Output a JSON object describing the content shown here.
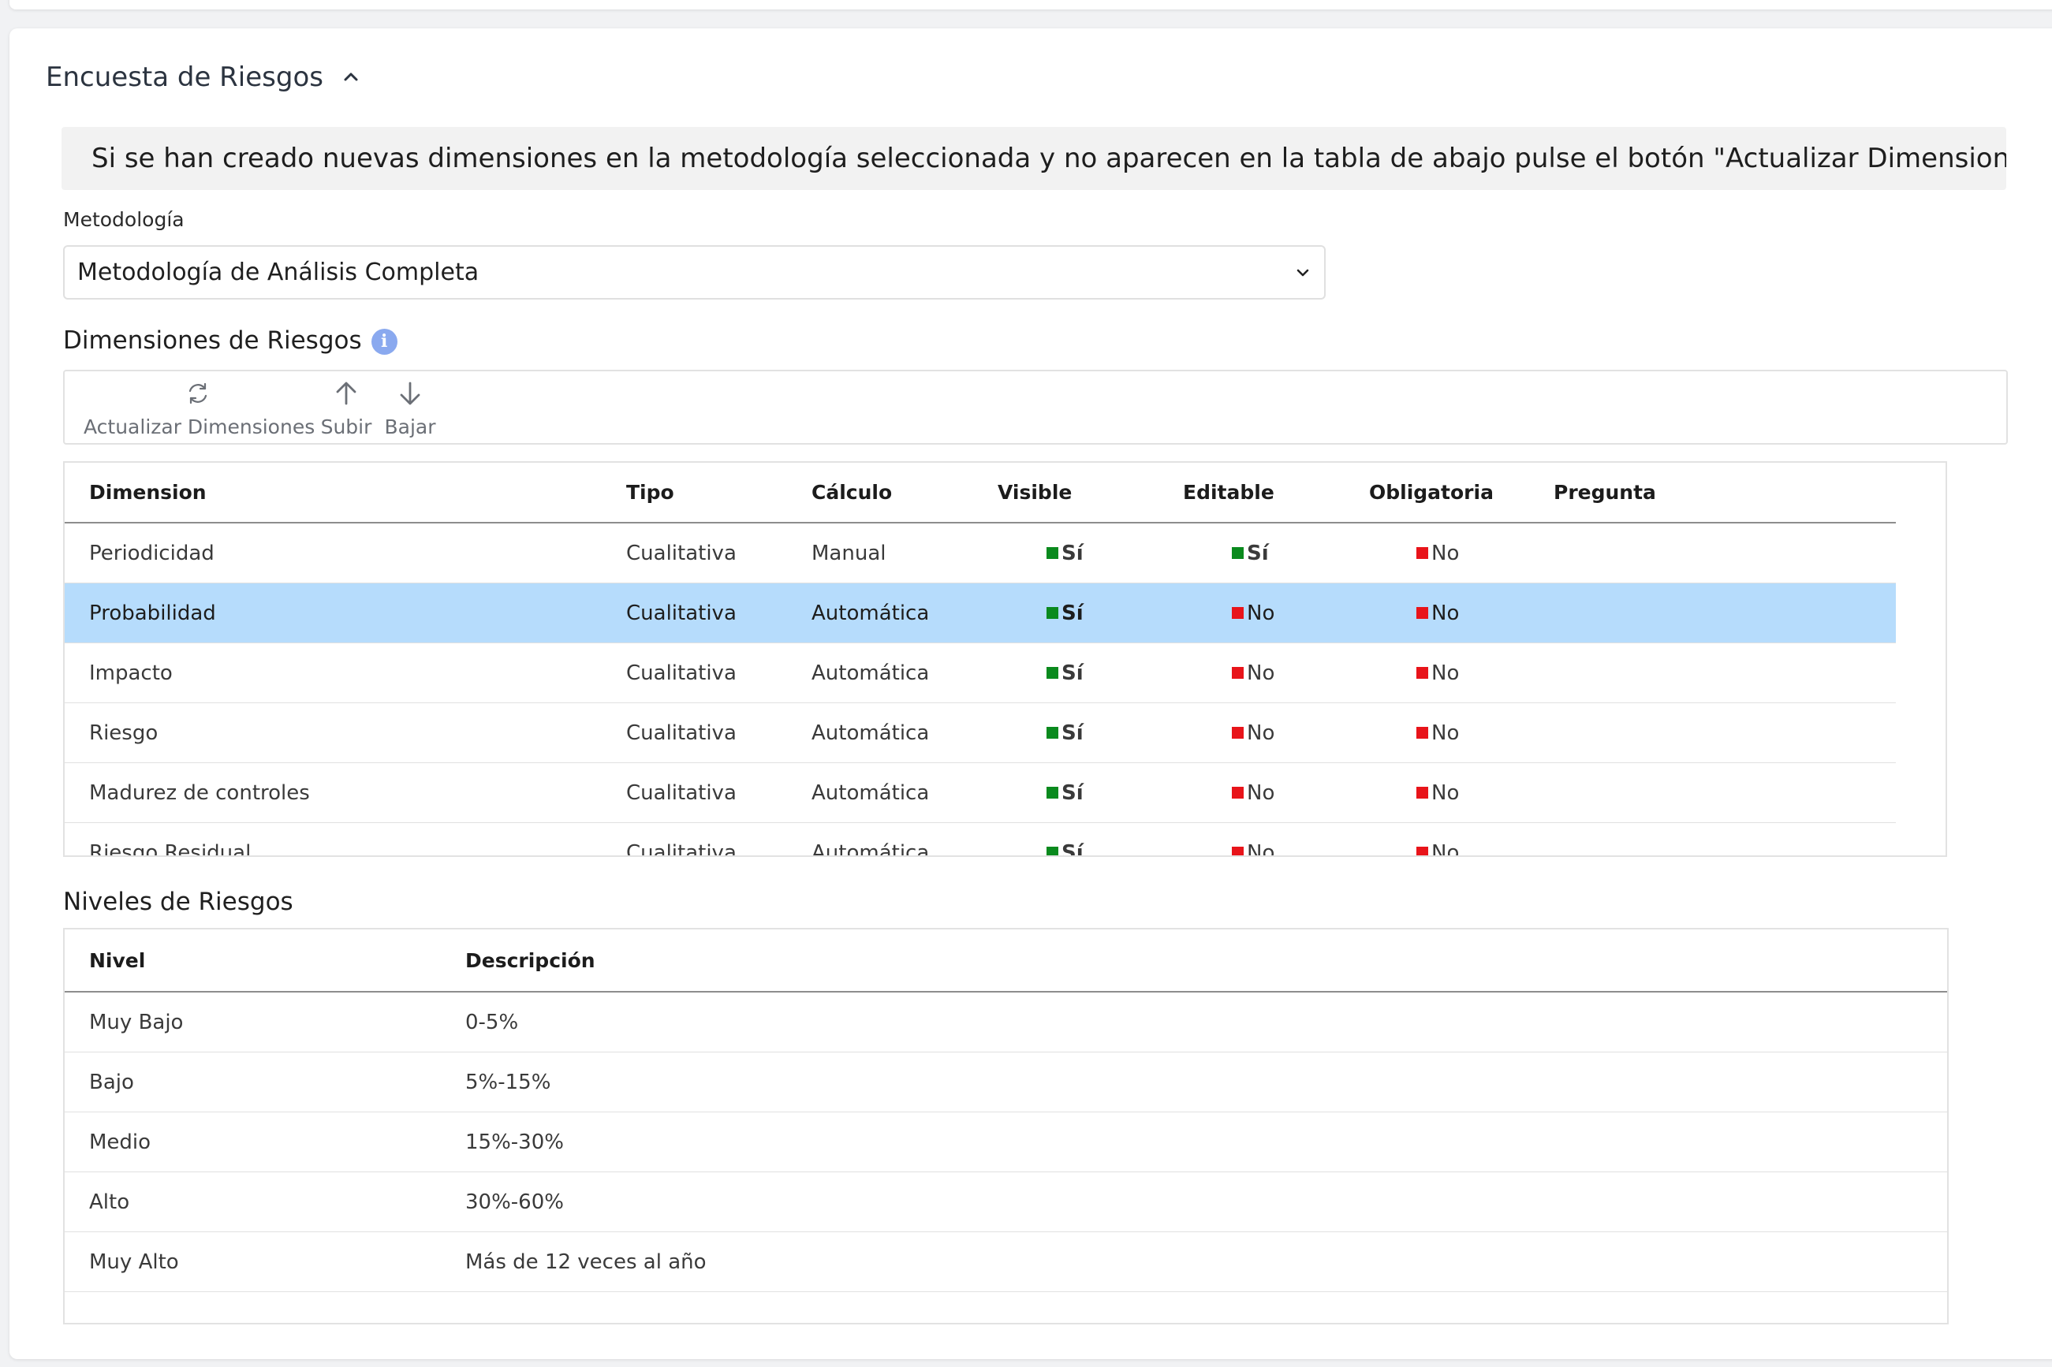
{
  "section": {
    "title": "Encuesta de Riesgos"
  },
  "banner": {
    "text": "Si se han creado nuevas dimensiones en la metodología seleccionada y no aparecen en la tabla de abajo pulse el botón \"Actualizar Dimensiones\""
  },
  "methodology": {
    "label": "Metodología",
    "selected": "Metodología de Análisis Completa"
  },
  "dimensions": {
    "title": "Dimensiones de Riesgos",
    "info_icon": "i",
    "toolbar": {
      "refresh_label": "Actualizar Dimensiones",
      "up_label": "Subir",
      "down_label": "Bajar"
    },
    "columns": [
      "Dimension",
      "Tipo",
      "Cálculo",
      "Visible",
      "Editable",
      "Obligatoria",
      "Pregunta"
    ],
    "rows": [
      {
        "dimension": "Periodicidad",
        "tipo": "Cualitativa",
        "calculo": "Manual",
        "visible": "Sí",
        "editable": "Sí",
        "obligatoria": "No",
        "pregunta": ""
      },
      {
        "dimension": "Probabilidad",
        "tipo": "Cualitativa",
        "calculo": "Automática",
        "visible": "Sí",
        "editable": "No",
        "obligatoria": "No",
        "pregunta": ""
      },
      {
        "dimension": "Impacto",
        "tipo": "Cualitativa",
        "calculo": "Automática",
        "visible": "Sí",
        "editable": "No",
        "obligatoria": "No",
        "pregunta": ""
      },
      {
        "dimension": "Riesgo",
        "tipo": "Cualitativa",
        "calculo": "Automática",
        "visible": "Sí",
        "editable": "No",
        "obligatoria": "No",
        "pregunta": ""
      },
      {
        "dimension": "Madurez de controles",
        "tipo": "Cualitativa",
        "calculo": "Automática",
        "visible": "Sí",
        "editable": "No",
        "obligatoria": "No",
        "pregunta": ""
      },
      {
        "dimension": "Riesgo Residual",
        "tipo": "Cualitativa",
        "calculo": "Automática",
        "visible": "Sí",
        "editable": "No",
        "obligatoria": "No",
        "pregunta": ""
      }
    ]
  },
  "levels": {
    "title": "Niveles de Riesgos",
    "columns": [
      "Nivel",
      "Descripción"
    ],
    "rows": [
      {
        "nivel": "Muy Bajo",
        "descripcion": "0-5%"
      },
      {
        "nivel": "Bajo",
        "descripcion": "5%-15%"
      },
      {
        "nivel": "Medio",
        "descripcion": "15%-30%"
      },
      {
        "nivel": "Alto",
        "descripcion": "30%-60%"
      },
      {
        "nivel": "Muy Alto",
        "descripcion": "Más de 12 veces al año"
      }
    ]
  },
  "colors": {
    "yes": "#0a8a1e",
    "no": "#e8141a",
    "selected_row": "#b6dcfc",
    "info_icon": "#8aa9ef"
  },
  "icons": {
    "section_toggle": "chevron-up-icon",
    "select_toggle": "chevron-down-icon",
    "refresh": "refresh-icon",
    "up": "arrow-up-icon",
    "down": "arrow-down-icon",
    "info": "info-icon"
  }
}
